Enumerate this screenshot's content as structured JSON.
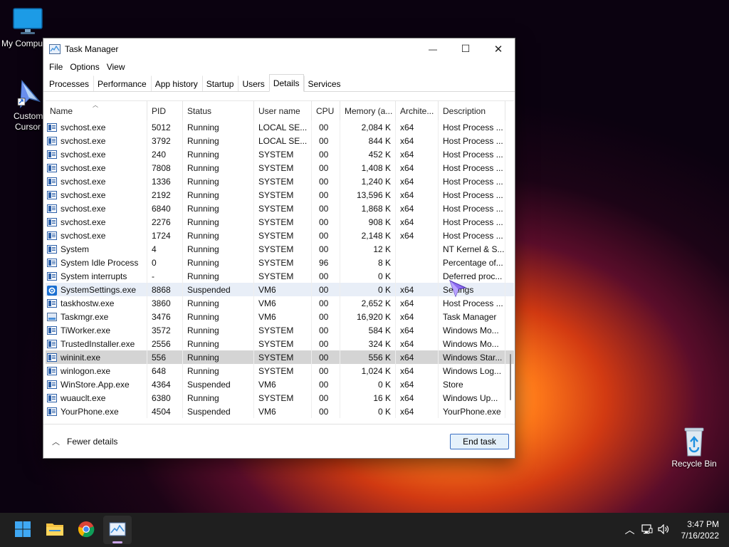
{
  "desktop": {
    "icons": [
      {
        "label": "My Compu",
        "icon": "monitor-icon"
      },
      {
        "label": "Custom Cursor",
        "icon": "cursor-icon"
      },
      {
        "label": "Recycle Bin",
        "icon": "recycle-bin-icon"
      }
    ]
  },
  "window": {
    "title": "Task Manager",
    "controls": {
      "minimize": "—",
      "maximize": "☐",
      "close": "✕"
    }
  },
  "menu": [
    "File",
    "Options",
    "View"
  ],
  "tabs": [
    {
      "label": "Processes",
      "active": false
    },
    {
      "label": "Performance",
      "active": false
    },
    {
      "label": "App history",
      "active": false
    },
    {
      "label": "Startup",
      "active": false
    },
    {
      "label": "Users",
      "active": false
    },
    {
      "label": "Details",
      "active": true
    },
    {
      "label": "Services",
      "active": false
    }
  ],
  "columns": [
    "Name",
    "PID",
    "Status",
    "User name",
    "CPU",
    "Memory (a...",
    "Archite...",
    "Description"
  ],
  "rows": [
    {
      "name": "svchost.exe",
      "pid": "5012",
      "status": "Running",
      "user": "LOCAL SE...",
      "cpu": "00",
      "mem": "2,084 K",
      "arch": "x64",
      "desc": "Host Process ...",
      "icon": "process-icon"
    },
    {
      "name": "svchost.exe",
      "pid": "3792",
      "status": "Running",
      "user": "LOCAL SE...",
      "cpu": "00",
      "mem": "844 K",
      "arch": "x64",
      "desc": "Host Process ...",
      "icon": "process-icon"
    },
    {
      "name": "svchost.exe",
      "pid": "240",
      "status": "Running",
      "user": "SYSTEM",
      "cpu": "00",
      "mem": "452 K",
      "arch": "x64",
      "desc": "Host Process ...",
      "icon": "process-icon"
    },
    {
      "name": "svchost.exe",
      "pid": "7808",
      "status": "Running",
      "user": "SYSTEM",
      "cpu": "00",
      "mem": "1,408 K",
      "arch": "x64",
      "desc": "Host Process ...",
      "icon": "process-icon"
    },
    {
      "name": "svchost.exe",
      "pid": "1336",
      "status": "Running",
      "user": "SYSTEM",
      "cpu": "00",
      "mem": "1,240 K",
      "arch": "x64",
      "desc": "Host Process ...",
      "icon": "process-icon"
    },
    {
      "name": "svchost.exe",
      "pid": "2192",
      "status": "Running",
      "user": "SYSTEM",
      "cpu": "00",
      "mem": "13,596 K",
      "arch": "x64",
      "desc": "Host Process ...",
      "icon": "process-icon"
    },
    {
      "name": "svchost.exe",
      "pid": "6840",
      "status": "Running",
      "user": "SYSTEM",
      "cpu": "00",
      "mem": "1,868 K",
      "arch": "x64",
      "desc": "Host Process ...",
      "icon": "process-icon"
    },
    {
      "name": "svchost.exe",
      "pid": "2276",
      "status": "Running",
      "user": "SYSTEM",
      "cpu": "00",
      "mem": "908 K",
      "arch": "x64",
      "desc": "Host Process ...",
      "icon": "process-icon"
    },
    {
      "name": "svchost.exe",
      "pid": "1724",
      "status": "Running",
      "user": "SYSTEM",
      "cpu": "00",
      "mem": "2,148 K",
      "arch": "x64",
      "desc": "Host Process ...",
      "icon": "process-icon"
    },
    {
      "name": "System",
      "pid": "4",
      "status": "Running",
      "user": "SYSTEM",
      "cpu": "00",
      "mem": "12 K",
      "arch": "",
      "desc": "NT Kernel & S...",
      "icon": "process-icon"
    },
    {
      "name": "System Idle Process",
      "pid": "0",
      "status": "Running",
      "user": "SYSTEM",
      "cpu": "96",
      "mem": "8 K",
      "arch": "",
      "desc": "Percentage of...",
      "icon": "process-icon"
    },
    {
      "name": "System interrupts",
      "pid": "-",
      "status": "Running",
      "user": "SYSTEM",
      "cpu": "00",
      "mem": "0 K",
      "arch": "",
      "desc": "Deferred proc...",
      "icon": "process-icon"
    },
    {
      "name": "SystemSettings.exe",
      "pid": "8868",
      "status": "Suspended",
      "user": "VM6",
      "cpu": "00",
      "mem": "0 K",
      "arch": "x64",
      "desc": "Settings",
      "icon": "gear-icon",
      "state": "hover"
    },
    {
      "name": "taskhostw.exe",
      "pid": "3860",
      "status": "Running",
      "user": "VM6",
      "cpu": "00",
      "mem": "2,652 K",
      "arch": "x64",
      "desc": "Host Process ...",
      "icon": "process-icon"
    },
    {
      "name": "Taskmgr.exe",
      "pid": "3476",
      "status": "Running",
      "user": "VM6",
      "cpu": "00",
      "mem": "16,920 K",
      "arch": "x64",
      "desc": "Task Manager",
      "icon": "chart-icon"
    },
    {
      "name": "TiWorker.exe",
      "pid": "3572",
      "status": "Running",
      "user": "SYSTEM",
      "cpu": "00",
      "mem": "584 K",
      "arch": "x64",
      "desc": "Windows Mo...",
      "icon": "process-icon"
    },
    {
      "name": "TrustedInstaller.exe",
      "pid": "2556",
      "status": "Running",
      "user": "SYSTEM",
      "cpu": "00",
      "mem": "324 K",
      "arch": "x64",
      "desc": "Windows Mo...",
      "icon": "process-icon"
    },
    {
      "name": "wininit.exe",
      "pid": "556",
      "status": "Running",
      "user": "SYSTEM",
      "cpu": "00",
      "mem": "556 K",
      "arch": "x64",
      "desc": "Windows Star...",
      "icon": "process-icon",
      "state": "selected"
    },
    {
      "name": "winlogon.exe",
      "pid": "648",
      "status": "Running",
      "user": "SYSTEM",
      "cpu": "00",
      "mem": "1,024 K",
      "arch": "x64",
      "desc": "Windows Log...",
      "icon": "process-icon"
    },
    {
      "name": "WinStore.App.exe",
      "pid": "4364",
      "status": "Suspended",
      "user": "VM6",
      "cpu": "00",
      "mem": "0 K",
      "arch": "x64",
      "desc": "Store",
      "icon": "process-icon"
    },
    {
      "name": "wuauclt.exe",
      "pid": "6380",
      "status": "Running",
      "user": "SYSTEM",
      "cpu": "00",
      "mem": "16 K",
      "arch": "x64",
      "desc": "Windows Up...",
      "icon": "process-icon"
    },
    {
      "name": "YourPhone.exe",
      "pid": "4504",
      "status": "Suspended",
      "user": "VM6",
      "cpu": "00",
      "mem": "0 K",
      "arch": "x64",
      "desc": "YourPhone.exe",
      "icon": "process-icon"
    }
  ],
  "footer": {
    "fewer_details": "Fewer details",
    "end_task": "End task"
  },
  "taskbar": {
    "apps": [
      "start-icon",
      "file-explorer-icon",
      "chrome-icon",
      "task-manager-icon"
    ],
    "tray": [
      "chevron-up-icon",
      "network-icon",
      "volume-icon"
    ],
    "time": "3:47 PM",
    "date": "7/16/2022"
  },
  "colors": {
    "accent": "#0078d4",
    "selected_row": "#d4d4d4",
    "hover_row": "#e8eef7",
    "taskbar": "#1f1f1f"
  }
}
